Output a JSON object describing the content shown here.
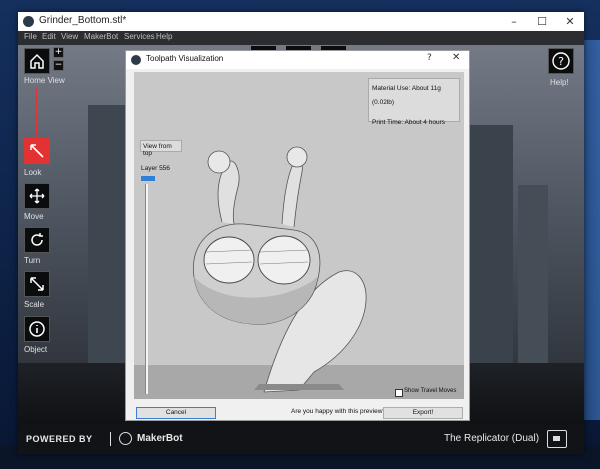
{
  "window": {
    "title": "Grinder_Bottom.stl*",
    "minimize_icon": "–",
    "maximize_icon": "☐",
    "close_icon": "✕"
  },
  "menu": [
    "File",
    "Edit",
    "View",
    "MakerBot",
    "Services",
    "Help"
  ],
  "left_tools": [
    {
      "label": "Home View"
    },
    {
      "label": "Look"
    },
    {
      "label": "Move"
    },
    {
      "label": "Turn"
    },
    {
      "label": "Scale"
    },
    {
      "label": "Object"
    }
  ],
  "zoom": {
    "plus": "+",
    "minus": "−"
  },
  "help": {
    "glyph": "?",
    "label": "Help!"
  },
  "bottom_bar": {
    "powered_by": "POWERED BY",
    "brand": "MakerBot",
    "printer": "The Replicator (Dual)"
  },
  "dialog": {
    "title": "Toolpath Visualization",
    "help_glyph": "?",
    "close_glyph": "✕",
    "view_button": "View from top",
    "layer_label": "Layer 556",
    "material_use": "Material Use: About 11g (0.02lb)",
    "print_time": "Print Time: About 4 hours",
    "show_travel": "Show Travel Moves",
    "show_travel_checked": false,
    "question": "Are you happy with this preview?",
    "cancel": "Cancel",
    "export": "Export!"
  },
  "colors": {
    "accent_active": "#e23234",
    "slider": "#2f7fd8"
  }
}
